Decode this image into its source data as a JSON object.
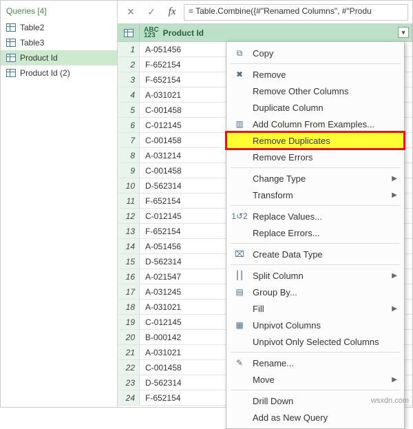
{
  "sidebar": {
    "header": "Queries [4]",
    "items": [
      {
        "label": "Table2"
      },
      {
        "label": "Table3"
      },
      {
        "label": "Product Id",
        "selected": true
      },
      {
        "label": "Product Id (2)"
      }
    ]
  },
  "formula_bar": {
    "value": "= Table.Combine({#\"Renamed Columns\", #\"Produ"
  },
  "grid": {
    "column_header": "Product Id",
    "rows": [
      "A-051456",
      "F-652154",
      "F-652154",
      "A-031021",
      "C-001458",
      "C-012145",
      "C-001458",
      "A-031214",
      "C-001458",
      "D-562314",
      "F-652154",
      "C-012145",
      "F-652154",
      "A-051456",
      "D-562314",
      "A-021547",
      "A-031245",
      "A-031021",
      "C-012145",
      "B-000142",
      "A-031021",
      "C-001458",
      "D-562314",
      "F-652154"
    ]
  },
  "menu": {
    "copy": "Copy",
    "remove": "Remove",
    "remove_other": "Remove Other Columns",
    "duplicate": "Duplicate Column",
    "add_examples": "Add Column From Examples...",
    "remove_dup": "Remove Duplicates",
    "remove_err": "Remove Errors",
    "change_type": "Change Type",
    "transform": "Transform",
    "replace_vals": "Replace Values...",
    "replace_err": "Replace Errors...",
    "create_dt": "Create Data Type",
    "split_col": "Split Column",
    "group_by": "Group By...",
    "fill": "Fill",
    "unpivot": "Unpivot Columns",
    "unpivot_sel": "Unpivot Only Selected Columns",
    "rename": "Rename...",
    "move": "Move",
    "drill": "Drill Down",
    "add_new": "Add as New Query"
  },
  "watermark": "wsxdn.com"
}
